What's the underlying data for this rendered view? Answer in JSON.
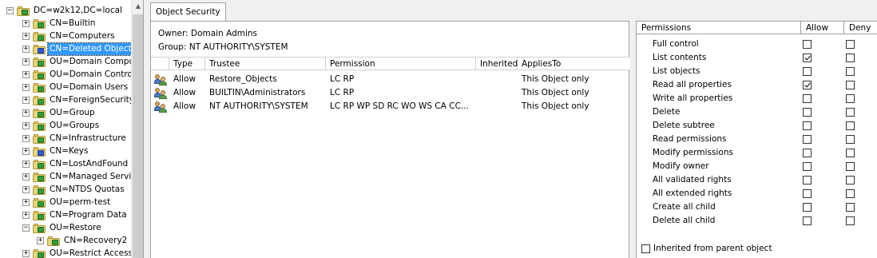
{
  "tree": {
    "root": "DC=w2k12,DC=local",
    "items": [
      {
        "label": "CN=Builtin",
        "expander": "+",
        "icon": "green"
      },
      {
        "label": "CN=Computers",
        "expander": "+",
        "icon": "green"
      },
      {
        "label": "CN=Deleted Objects",
        "expander": "+",
        "icon": "blue",
        "selected": true
      },
      {
        "label": "OU=Domain Comput",
        "expander": "+",
        "icon": "green"
      },
      {
        "label": "OU=Domain Controll",
        "expander": "+",
        "icon": "green"
      },
      {
        "label": "OU=Domain Users",
        "expander": "+",
        "icon": "green"
      },
      {
        "label": "CN=ForeignSecurityP",
        "expander": "+",
        "icon": "green"
      },
      {
        "label": "OU=Group",
        "expander": "+",
        "icon": "green"
      },
      {
        "label": "OU=Groups",
        "expander": "+",
        "icon": "green"
      },
      {
        "label": "CN=Infrastructure",
        "expander": "+",
        "icon": "green"
      },
      {
        "label": "CN=Keys",
        "expander": "+",
        "icon": "blue"
      },
      {
        "label": "CN=LostAndFound",
        "expander": "+",
        "icon": "green"
      },
      {
        "label": "CN=Managed Servic",
        "expander": "+",
        "icon": "green"
      },
      {
        "label": "CN=NTDS Quotas",
        "expander": "+",
        "icon": "green"
      },
      {
        "label": "OU=perm-test",
        "expander": "+",
        "icon": "green"
      },
      {
        "label": "CN=Program Data",
        "expander": "+",
        "icon": "green"
      },
      {
        "label": "OU=Restore",
        "expander": "-",
        "icon": "green"
      },
      {
        "label": "CN=Recovery2",
        "expander": "+",
        "icon": "green",
        "child": true
      },
      {
        "label": "OU=Restrict Access",
        "expander": "+",
        "icon": "green"
      }
    ]
  },
  "tab": {
    "label": "Object Security"
  },
  "owner": {
    "label": "Owner:",
    "value": "Domain Admins"
  },
  "group": {
    "label": "Group:",
    "value": "NT AUTHORITY\\SYSTEM"
  },
  "acl": {
    "columns": [
      "Type",
      "Trustee",
      "Permission",
      "Inherited",
      "AppliesTo"
    ],
    "rows": [
      {
        "type": "Allow",
        "trustee": "Restore_Objects",
        "permission": "LC RP",
        "inherited": "",
        "applies": "This Object only"
      },
      {
        "type": "Allow",
        "trustee": "BUILTIN\\Administrators",
        "permission": "LC RP",
        "inherited": "",
        "applies": "This Object only"
      },
      {
        "type": "Allow",
        "trustee": "NT AUTHORITY\\SYSTEM",
        "permission": "LC RP WP SD RC WO WS CA CC...",
        "inherited": "",
        "applies": "This Object only"
      }
    ]
  },
  "permissions": {
    "columns": [
      "Permissions",
      "Allow",
      "Deny"
    ],
    "rows": [
      {
        "label": "Full control",
        "allow": false,
        "deny": false
      },
      {
        "label": "List contents",
        "allow": true,
        "deny": false
      },
      {
        "label": "List objects",
        "allow": false,
        "deny": false
      },
      {
        "label": "Read all properties",
        "allow": true,
        "deny": false
      },
      {
        "label": "Write all properties",
        "allow": false,
        "deny": false
      },
      {
        "label": "Delete",
        "allow": false,
        "deny": false
      },
      {
        "label": "Delete subtree",
        "allow": false,
        "deny": false
      },
      {
        "label": "Read permissions",
        "allow": false,
        "deny": false
      },
      {
        "label": "Modify permissions",
        "allow": false,
        "deny": false
      },
      {
        "label": "Modify owner",
        "allow": false,
        "deny": false
      },
      {
        "label": "All validated rights",
        "allow": false,
        "deny": false
      },
      {
        "label": "All extended rights",
        "allow": false,
        "deny": false
      },
      {
        "label": "Create all child",
        "allow": false,
        "deny": false
      },
      {
        "label": "Delete all child",
        "allow": false,
        "deny": false
      }
    ],
    "inherited_label": "Inherited from parent object",
    "inherited_checked": false
  }
}
